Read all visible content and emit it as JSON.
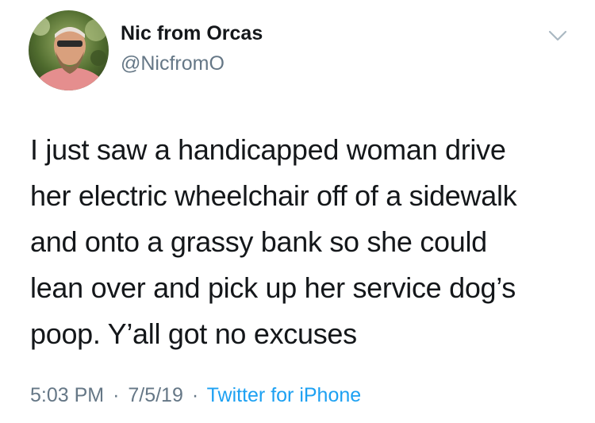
{
  "author": {
    "display_name": "Nic from Orcas",
    "handle": "@NicfromO",
    "avatar": "profile-photo"
  },
  "menu": {
    "icon": "chevron-down-icon"
  },
  "tweet": {
    "lines": [
      "I just saw a handicapped woman drive",
      "her electric wheelchair off of a sidewalk",
      "and onto a grassy bank so she could",
      "lean over and pick up her service dog’s",
      "poop.  Y’all got no excuses"
    ]
  },
  "meta": {
    "time": "5:03 PM",
    "separator": "·",
    "date": "7/5/19",
    "source": "Twitter for iPhone"
  },
  "colors": {
    "text": "#14171a",
    "secondary": "#657786",
    "link": "#1da1f2",
    "background": "#ffffff"
  }
}
